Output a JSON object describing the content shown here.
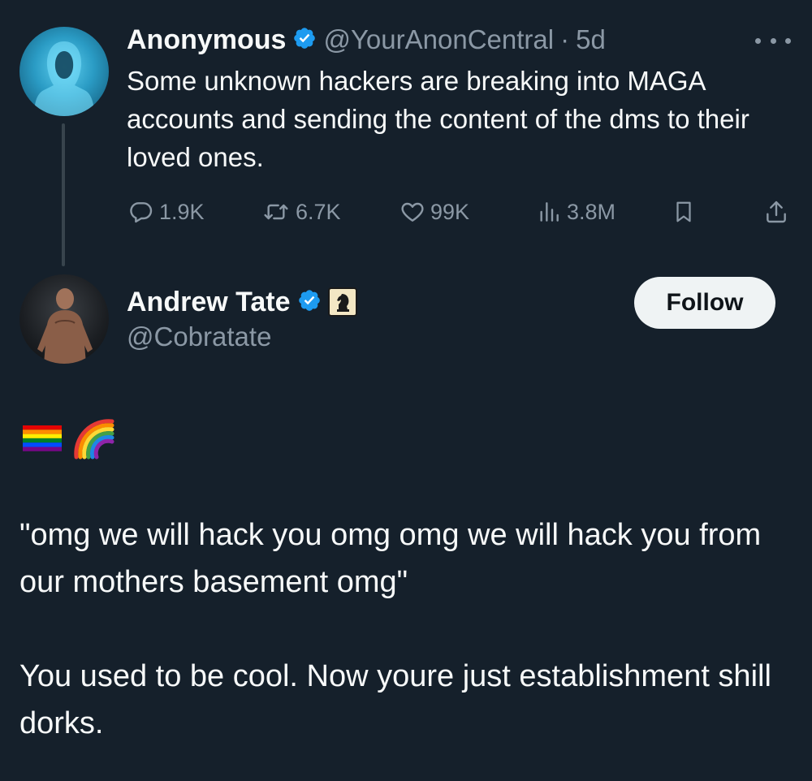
{
  "tweet": {
    "display_name": "Anonymous",
    "handle": "@YourAnonCentral",
    "separator": "·",
    "time": "5d",
    "text": "Some unknown hackers are breaking into MAGA accounts and sending the content of the dms to their loved ones.",
    "stats": {
      "replies": "1.9K",
      "reposts": "6.7K",
      "likes": "99K",
      "views": "3.8M"
    },
    "icons": {
      "avatar": "hooded-figure-avatar",
      "verified": "verified-badge-icon",
      "more": "more-icon",
      "reply": "reply-icon",
      "repost": "repost-icon",
      "like": "heart-icon",
      "views": "views-chart-icon",
      "bookmark": "bookmark-icon",
      "share": "share-icon"
    }
  },
  "quote": {
    "display_name": "Andrew Tate",
    "handle": "@Cobratate",
    "follow_label": "Follow",
    "emoji": [
      "🏳️‍🌈",
      "🌈"
    ],
    "text": "\"omg we will hack you omg omg we will hack you from our mothers basement omg\"\n\nYou used to be cool. Now youre just establishment shill dorks.",
    "icons": {
      "verified": "verified-badge-icon",
      "affiliate": "chess-knight-badge-icon"
    }
  },
  "colors": {
    "background": "#15202b",
    "primary_text": "#f7f9f9",
    "secondary_text": "#8b98a5",
    "verified_blue": "#1d9bf0",
    "button_bg": "#eff3f4",
    "button_text": "#0f1419",
    "thread_line": "#38444d"
  }
}
